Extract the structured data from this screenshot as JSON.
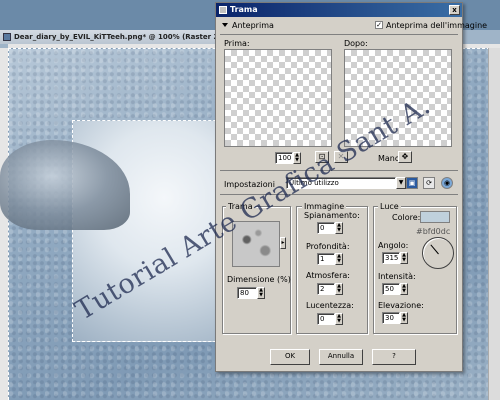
{
  "window": {
    "title": "Dear_diary_by_EVIL_KiTTeeh.png* @ 100% (Raster 2)"
  },
  "watermark": "Tutorial Arte Grafica Sant A.",
  "dialog": {
    "title": "Trama",
    "close": "x",
    "anteprima": "Anteprima",
    "anteprima_immagine": "Anteprima dell'immagine",
    "prima": "Prima:",
    "dopo": "Dopo:",
    "zoom_value": "100",
    "mano": "Mano:",
    "impostazioni_label": "Impostazioni",
    "impostazioni_value": "Ultimo utilizzo",
    "buttons": {
      "ok": "OK",
      "annulla": "Annulla",
      "help": "?"
    }
  },
  "trama_group": {
    "title": "Trama",
    "dimensione_label": "Dimensione (%)",
    "dimensione_value": "80"
  },
  "immagine_group": {
    "title": "Immagine",
    "spianamento_label": "Spianamento:",
    "spianamento_value": "0",
    "profondita_label": "Profondità:",
    "profondita_value": "1",
    "atmosfera_label": "Atmosfera:",
    "atmosfera_value": "2",
    "lucentezza_label": "Lucentezza:",
    "lucentezza_value": "0"
  },
  "luce_group": {
    "title": "Luce",
    "colore_label": "Colore:",
    "colore_hex": "#bfd0dc",
    "angolo_label": "Angolo:",
    "angolo_value": "315",
    "intensita_label": "Intensità:",
    "intensita_value": "50",
    "elevazione_label": "Elevazione:",
    "elevazione_value": "30"
  },
  "colors": {
    "swatch": "#bfd0dc",
    "titlebar": "#0a246a"
  }
}
